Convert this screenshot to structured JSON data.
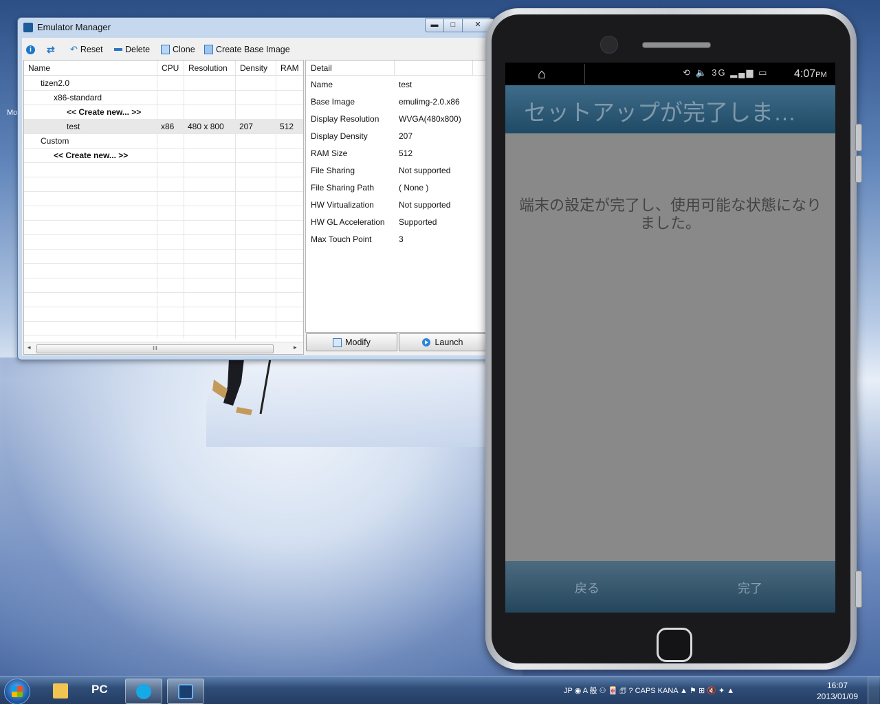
{
  "desktop": {
    "label": "Mo"
  },
  "window": {
    "title": "Emulator Manager",
    "controls": {
      "minimize": "▬",
      "maximize": "□",
      "close": "✕"
    },
    "toolbar": {
      "reset": "Reset",
      "delete": "Delete",
      "clone": "Clone",
      "create_base_image": "Create Base Image"
    },
    "tree": {
      "columns": [
        "Name",
        "CPU",
        "Resolution",
        "Density",
        "RAM"
      ],
      "rows": [
        {
          "name": "tizen2.0",
          "cpu": "",
          "resolution": "",
          "density": "",
          "ram": ""
        },
        {
          "name": "x86-standard",
          "cpu": "",
          "resolution": "",
          "density": "",
          "ram": ""
        },
        {
          "name": "<< Create new... >>",
          "cpu": "",
          "resolution": "",
          "density": "",
          "ram": ""
        },
        {
          "name": "test",
          "cpu": "x86",
          "resolution": "480 x 800",
          "density": "207",
          "ram": "512"
        },
        {
          "name": "Custom",
          "cpu": "",
          "resolution": "",
          "density": "",
          "ram": ""
        },
        {
          "name": "<< Create new... >>",
          "cpu": "",
          "resolution": "",
          "density": "",
          "ram": ""
        }
      ],
      "scroll_thumb": "III"
    },
    "detail": {
      "header": "Detail",
      "items": [
        {
          "label": "Name",
          "value": "test"
        },
        {
          "label": "Base Image",
          "value": "emulimg-2.0.x86"
        },
        {
          "label": "Display Resolution",
          "value": "WVGA(480x800)"
        },
        {
          "label": "Display Density",
          "value": "207"
        },
        {
          "label": "RAM Size",
          "value": "512"
        },
        {
          "label": "File Sharing",
          "value": "Not supported"
        },
        {
          "label": "File Sharing Path",
          "value": "( None )"
        },
        {
          "label": "HW Virtualization",
          "value": "Not supported"
        },
        {
          "label": "HW GL Acceleration",
          "value": "Supported"
        },
        {
          "label": "Max Touch Point",
          "value": "3"
        }
      ],
      "modify": "Modify",
      "launch": "Launch"
    }
  },
  "phone": {
    "status": {
      "icons": "⟲ 🔈 3G ▂▄▆ ▭",
      "time": "4:07",
      "ampm": "PM"
    },
    "title": "セットアップが完了しま…",
    "message": "端末の設定が完了し、使用可能な状態になりました。",
    "back": "戻る",
    "done": "完了"
  },
  "taskbar": {
    "pinned": [
      {
        "name": "explorer",
        "color": "#f2c552",
        "active": false
      },
      {
        "name": "pc",
        "color": "#2a63c7",
        "active": false,
        "text": "PC"
      },
      {
        "name": "skype",
        "color": "#17a8e6",
        "active": true
      },
      {
        "name": "emulator",
        "color": "#1a3f6e",
        "active": true
      }
    ],
    "tray_text": "JP  ◉ A 般 ⚇ 🀄 🗊 ?  CAPS KANA  ▲  ⚑ ⊞ 🔇 ✦ ▲",
    "time": "16:07",
    "date": "2013/01/09"
  }
}
